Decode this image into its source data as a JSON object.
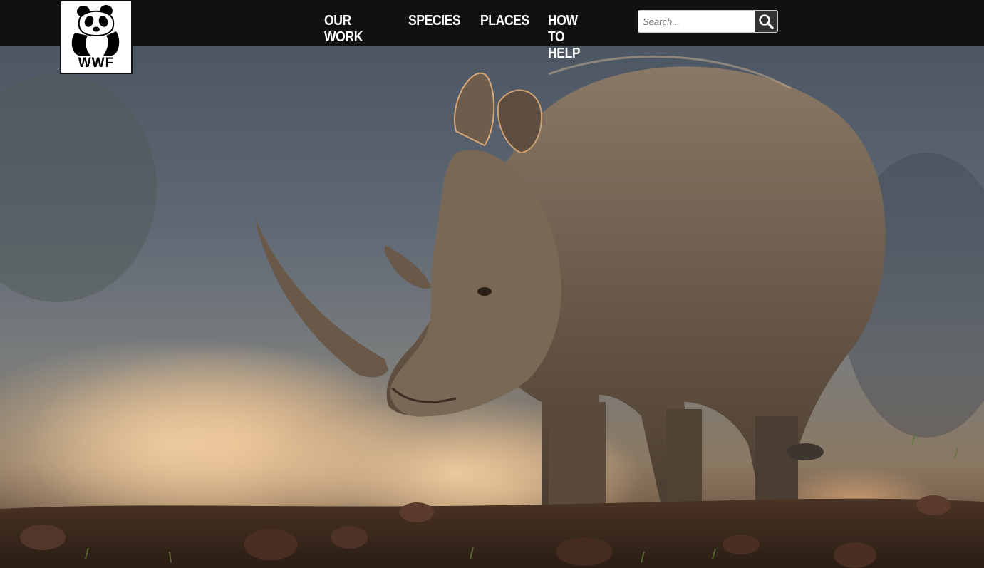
{
  "brand": {
    "logo_text": "WWF",
    "logo_icon": "panda-icon"
  },
  "nav": {
    "items": [
      {
        "label": "OUR WORK"
      },
      {
        "label": "SPECIES"
      },
      {
        "label": "PLACES"
      },
      {
        "label": "HOW TO HELP"
      }
    ]
  },
  "search": {
    "placeholder": "Search...",
    "value": "",
    "icon": "search-icon"
  },
  "hero": {
    "image": "white-rhinoceros-in-dust",
    "alt_subject": "rhino"
  },
  "colors": {
    "topbar": "#111111",
    "nav_text": "#ffffff",
    "search_button": "#333333"
  }
}
